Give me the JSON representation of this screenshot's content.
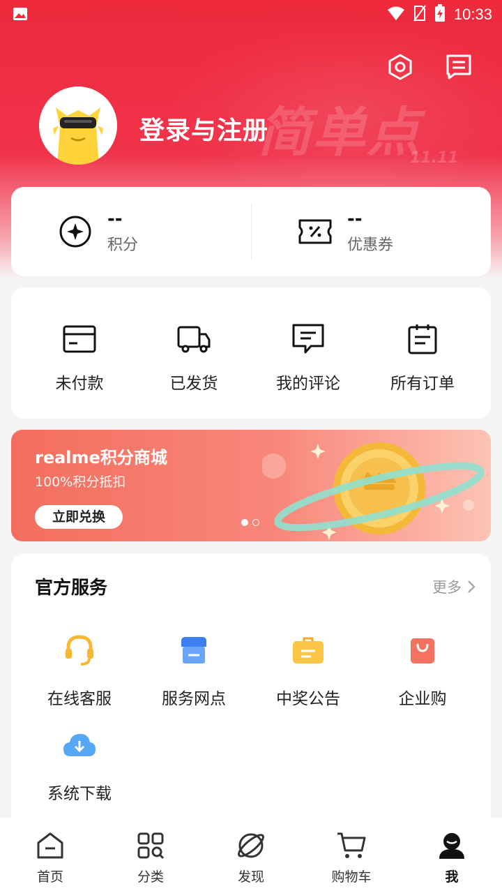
{
  "status_bar": {
    "time": "10:33"
  },
  "profile": {
    "login_text": "登录与注册"
  },
  "stats": [
    {
      "value": "--",
      "label": "积分",
      "icon": "points-icon"
    },
    {
      "value": "--",
      "label": "优惠券",
      "icon": "coupon-icon"
    }
  ],
  "orders": [
    {
      "label": "未付款",
      "icon": "card-icon"
    },
    {
      "label": "已发货",
      "icon": "truck-icon"
    },
    {
      "label": "我的评论",
      "icon": "comment-icon"
    },
    {
      "label": "所有订单",
      "icon": "order-list-icon"
    }
  ],
  "banner": {
    "title": "realme积分商城",
    "subtitle": "100%积分抵扣",
    "button": "立即兑换",
    "slide_count": 2,
    "active_slide": 1
  },
  "services": {
    "title": "官方服务",
    "more": "更多",
    "items": [
      {
        "label": "在线客服",
        "icon": "headset-icon",
        "color": "#f7b731"
      },
      {
        "label": "服务网点",
        "icon": "store-icon",
        "color": "#4a8df6"
      },
      {
        "label": "中奖公告",
        "icon": "prize-bag-icon",
        "color": "#f7b731"
      },
      {
        "label": "企业购",
        "icon": "shopping-bag-icon",
        "color": "#f4725f"
      },
      {
        "label": "系统下载",
        "icon": "cloud-download-icon",
        "color": "#4aa3f6"
      }
    ]
  },
  "tabbar": [
    {
      "label": "首页",
      "icon": "home-icon"
    },
    {
      "label": "分类",
      "icon": "category-icon"
    },
    {
      "label": "发现",
      "icon": "planet-icon"
    },
    {
      "label": "购物车",
      "icon": "cart-icon"
    },
    {
      "label": "我",
      "icon": "profile-icon",
      "active": true
    }
  ],
  "colors": {
    "brand_red": "#ee2a3c",
    "banner_orange": "#f36e5e"
  }
}
